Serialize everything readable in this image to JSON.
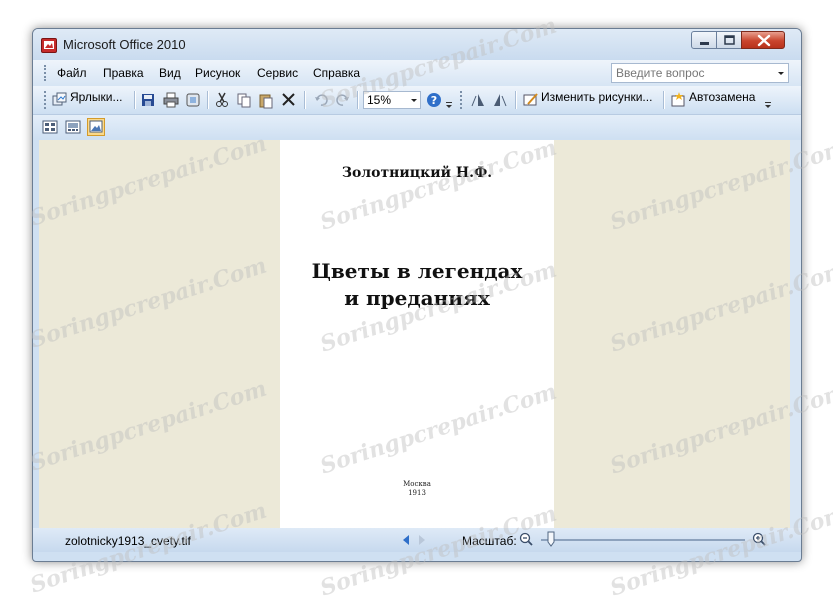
{
  "window": {
    "title": "Microsoft Office 2010"
  },
  "menu": {
    "items": [
      {
        "label": "Файл"
      },
      {
        "label": "Правка"
      },
      {
        "label": "Вид"
      },
      {
        "label": "Рисунок"
      },
      {
        "label": "Сервис"
      },
      {
        "label": "Справка"
      }
    ],
    "help_placeholder": "Введите вопрос"
  },
  "toolbar": {
    "shortcuts_label": "Ярлыки...",
    "zoom_value": "15%",
    "edit_pictures_label": "Изменить рисунки...",
    "autocorrect_label": "Автозамена"
  },
  "document": {
    "author": "Золотницкий Н.Ф.",
    "title_line1": "Цветы в легендах",
    "title_line2": "и преданиях",
    "city": "Москва",
    "year": "1913"
  },
  "status": {
    "filename": "zolotnicky1913_cvety.tif",
    "scale_label": "Масштаб:",
    "zoom_level": 0.05
  },
  "watermark": {
    "text": "Soringpcrepair.Com"
  },
  "colors": {
    "frame": "#cfe0f2",
    "canvas": "#ece9d8",
    "page": "#ffffff",
    "close_button": "#c9452d"
  }
}
